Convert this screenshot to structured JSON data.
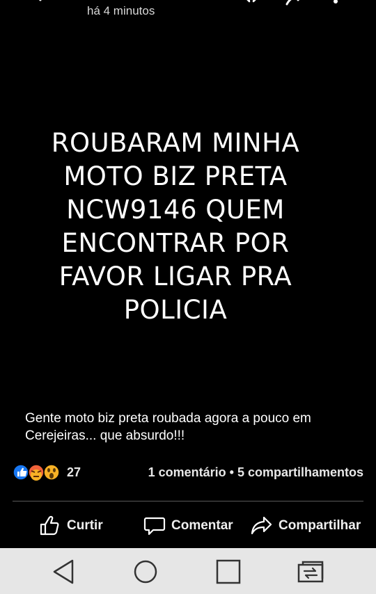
{
  "header": {
    "timestamp": "há 4 minutos",
    "icons": [
      "back-arrow-icon",
      "star-icon",
      "share-icon",
      "more-vertical-icon"
    ]
  },
  "post": {
    "image_text_lines": [
      "ROUBARAM MINHA",
      "MOTO BIZ PRETA",
      "NCW9146 QUEM",
      "ENCONTRAR POR",
      "FAVOR LIGAR PRA",
      "POLICIA"
    ],
    "caption": "Gente moto biz preta roubada agora a pouco em Cerejeiras... que absurdo!!!"
  },
  "reactions": {
    "icons": [
      "like-reaction-icon",
      "angry-reaction-icon",
      "wow-reaction-icon"
    ],
    "count": "27",
    "comments": "1 comentário",
    "separator": "•",
    "shares": "5 compartilhamentos"
  },
  "actions": {
    "like_label": "Curtir",
    "comment_label": "Comentar",
    "share_label": "Compartilhar"
  },
  "navbar": {
    "icons": [
      "nav-back-icon",
      "nav-home-icon",
      "nav-recents-icon",
      "nav-switch-icon"
    ]
  },
  "colors": {
    "background": "#000000",
    "like_blue": "#1877f2",
    "angry_orange": "#f0623a",
    "wow_yellow": "#f7b125",
    "navbar_bg": "#e6e6e6"
  }
}
